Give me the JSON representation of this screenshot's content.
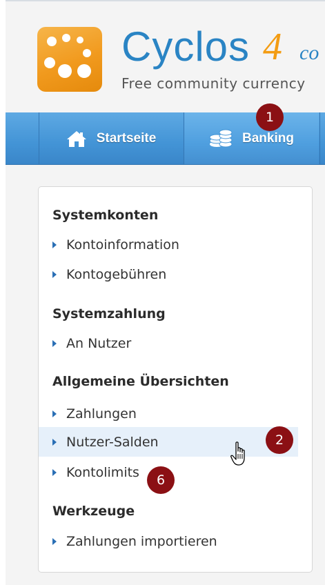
{
  "brand": {
    "name": "Cyclos",
    "version": "4",
    "version_suffix": "co",
    "tagline": "Free community currency"
  },
  "nav": {
    "items": [
      {
        "label": "Startseite",
        "icon": "home-icon"
      },
      {
        "label": "Banking",
        "icon": "coins-stack-icon"
      }
    ]
  },
  "callouts": {
    "one": "1",
    "two": "2",
    "six": "6"
  },
  "menu": {
    "sections": [
      {
        "title": "Systemkonten",
        "items": [
          "Kontoinformation",
          "Kontogebühren"
        ]
      },
      {
        "title": "Systemzahlung",
        "items": [
          "An Nutzer"
        ]
      },
      {
        "title": "Allgemeine Übersichten",
        "items": [
          "Zahlungen",
          "Nutzer-Salden",
          "Kontolimits"
        ]
      },
      {
        "title": "Werkzeuge",
        "items": [
          "Zahlungen importieren"
        ]
      }
    ]
  },
  "colors": {
    "brand_blue": "#2a84c4",
    "brand_orange": "#f39c12",
    "nav_blue": "#4394d6",
    "callout_red": "#8b1014",
    "hover_bg": "#e6f0fa"
  }
}
